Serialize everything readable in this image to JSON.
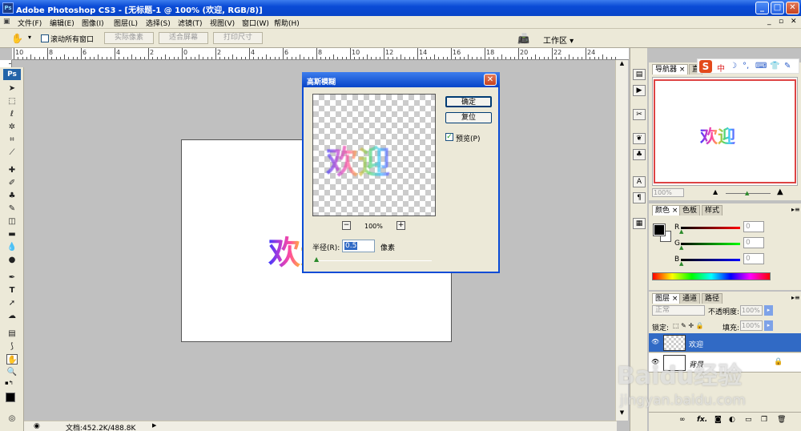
{
  "window": {
    "title": "Adobe Photoshop CS3 - [无标题-1 @ 100% (欢迎, RGB/8)]",
    "app_icon": "Ps"
  },
  "menu": [
    "文件(F)",
    "编辑(E)",
    "图像(I)",
    "图层(L)",
    "选择(S)",
    "滤镜(T)",
    "视图(V)",
    "窗口(W)",
    "帮助(H)"
  ],
  "options": {
    "scroll_all": "滚动所有窗口",
    "actual_pixels": "实际像素",
    "fit_screen": "适合屏幕",
    "print_size": "打印尺寸",
    "workspace": "工作区 ▾"
  },
  "toolbox": {
    "badge": "Ps"
  },
  "ruler": {
    "labels": [
      "10",
      "8",
      "6",
      "4",
      "2",
      "0",
      "2",
      "4",
      "6",
      "8",
      "10",
      "12",
      "14",
      "16",
      "18",
      "20",
      "22",
      "24"
    ]
  },
  "canvas": {
    "text": "欢迎"
  },
  "status": {
    "doc": "文档:452.2K/488.8K"
  },
  "dialog": {
    "title": "高斯模糊",
    "ok": "确定",
    "reset": "复位",
    "preview_label": "预览(P)",
    "preview_checked": true,
    "preview_text": "欢迎",
    "zoom": "100%",
    "radius_label": "半径(R):",
    "radius_value": "0.5",
    "unit": "像素"
  },
  "ime": {
    "items": [
      "中",
      "☽",
      "°,",
      "⌨",
      "👕",
      "✎"
    ]
  },
  "navigator": {
    "tabs": [
      "导航器",
      "直"
    ],
    "thumb_text": "欢迎",
    "zoom": "100%"
  },
  "color_panel": {
    "tabs": [
      "颜色",
      "色板",
      "样式"
    ],
    "r_label": "R",
    "g_label": "G",
    "b_label": "B",
    "r": "0",
    "g": "0",
    "b": "0"
  },
  "layers_panel": {
    "tabs": [
      "图层",
      "通道",
      "路径"
    ],
    "blend": "正常",
    "opacity_label": "不透明度:",
    "opacity": "100%",
    "lock_label": "锁定:",
    "fill_label": "填充:",
    "fill": "100%",
    "layers": [
      {
        "name": "欢迎"
      },
      {
        "name": "背景"
      }
    ]
  },
  "watermark": {
    "text": "Baidu经验",
    "url": "jingyan.baidu.com"
  },
  "colors": {
    "title_blue": "#0a4bd6",
    "selection_blue": "#316ac5",
    "chrome": "#ece9d8"
  }
}
